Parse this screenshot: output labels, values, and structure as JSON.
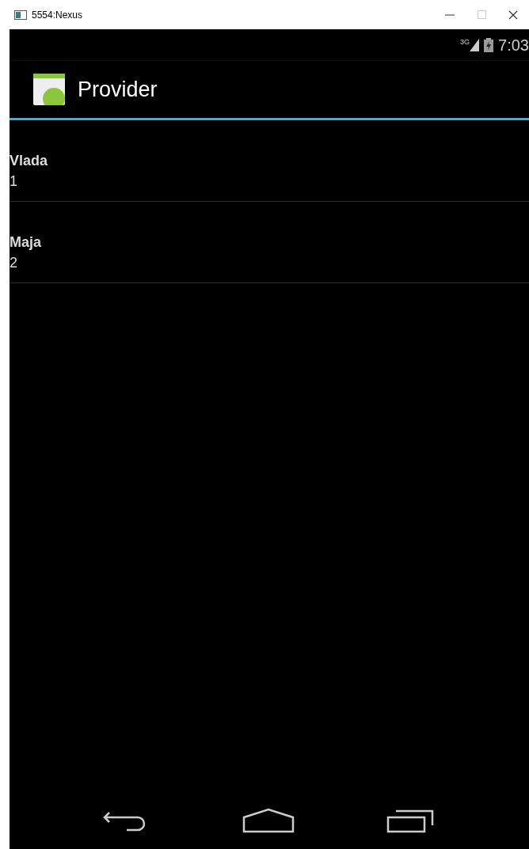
{
  "window": {
    "title": "5554:Nexus"
  },
  "status_bar": {
    "network": "3G",
    "time": "7:03"
  },
  "action_bar": {
    "title": "Provider"
  },
  "list": [
    {
      "name": "Vlada",
      "id": "1"
    },
    {
      "name": "Maja",
      "id": "2"
    }
  ]
}
